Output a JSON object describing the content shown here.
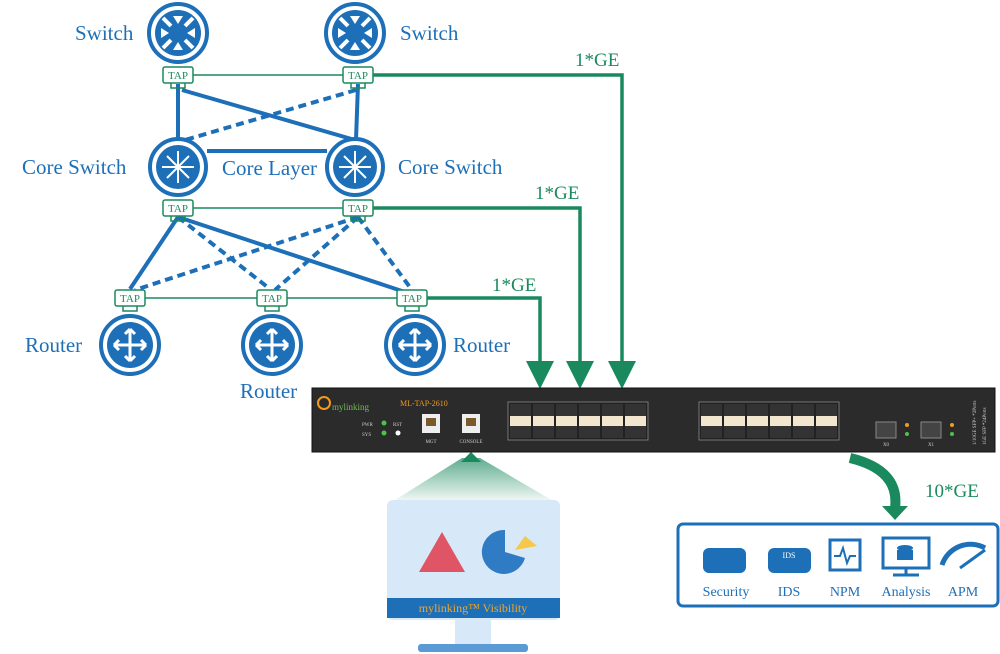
{
  "nodes": {
    "switch_left": "Switch",
    "switch_right": "Switch",
    "core_left": "Core Switch",
    "core_right": "Core Switch",
    "core_layer": "Core Layer",
    "router_left": "Router",
    "router_middle": "Router",
    "router_right": "Router",
    "tap": "TAP"
  },
  "links": {
    "ge1": "1*GE",
    "ge2": "1*GE",
    "ge3": "1*GE",
    "ge10": "10*GE"
  },
  "device": {
    "brand": "mylinking",
    "model": "ML-TAP-2610",
    "pwr": "PWR",
    "sys": "SYS",
    "rst": "RST",
    "mgt": "MGT",
    "console": "CONSOLE",
    "x0": "X0",
    "x1": "X1",
    "side_text_1": "1/10GE SFP+ *2Ports",
    "side_text_2": "1GE SFP *24Ports"
  },
  "tools": [
    "Security",
    "IDS",
    "NPM",
    "Analysis",
    "APM"
  ],
  "monitor": {
    "title": "mylinking™ Visibility"
  },
  "colors": {
    "blue": "#1d6fb8",
    "green": "#1a8a5e",
    "orange": "#f39a1e",
    "device": "#2b2b2b"
  }
}
